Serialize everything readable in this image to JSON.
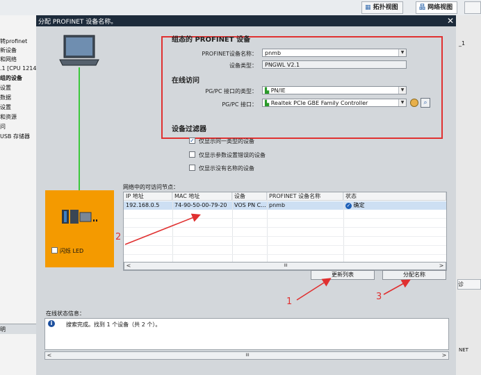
{
  "portal": {
    "topology_tab": "拓扑视图",
    "network_tab": "网络视图",
    "left_items": [
      "转profinet",
      "新设备",
      "和网络",
      ".1 [CPU 1214",
      "组的设备",
      "设置",
      "数据",
      "设置",
      "和资源",
      "问",
      "USB 存储器",
      "明"
    ],
    "right_items": [
      "_1",
      "诊",
      "NET"
    ]
  },
  "dialog": {
    "title": "分配 PROFINET 设备名称。",
    "close_glyph": "✕",
    "configured_section": "组态的 PROFINET 设备",
    "device_name_label": "PROFINET设备名称：",
    "device_name_value": "pnmb",
    "device_type_label": "设备类型：",
    "device_type_value": "PNGWL V2.1",
    "online_section": "在线访问",
    "pgpc_type_label": "PG/PC 接口的类型：",
    "pgpc_type_value": "PN/IE",
    "pgpc_iface_label": "PG/PC 接口：",
    "pgpc_iface_value": "Realtek PCIe GBE Family Controller",
    "filter_section": "设备过滤器",
    "filter1": "仅显示同一类型的设备",
    "filter2": "仅显示参数设置错误的设备",
    "filter3": "仅显示没有名称的设备",
    "flash_led": "闪烁 LED",
    "nodes_title": "网络中的可访问节点：",
    "columns": [
      "IP 地址",
      "MAC 地址",
      "设备",
      "PROFINET 设备名称",
      "状态"
    ],
    "row": {
      "ip": "192.168.0.5",
      "mac": "74-90-50-00-79-20",
      "device": "VOS PN C...",
      "name": "pnmb",
      "status": "确定"
    },
    "update_list": "更新列表",
    "assign_name": "分配名称",
    "status_title": "在线状态信息：",
    "status_message": "搜索完成。找到 1 个设备（共 2 个）。",
    "scroll_mid": "III",
    "scroll_left": "<",
    "scroll_right": ">"
  },
  "annotations": {
    "n1": "1",
    "n2": "2",
    "n3": "3",
    "color": "#e03030"
  },
  "colors": {
    "titlebar": "#1d2b3b",
    "highlight_box": "#e03030",
    "orange_panel": "#f49a00",
    "cable": "#3bc83b",
    "dialog_bg": "#d3d7db"
  }
}
